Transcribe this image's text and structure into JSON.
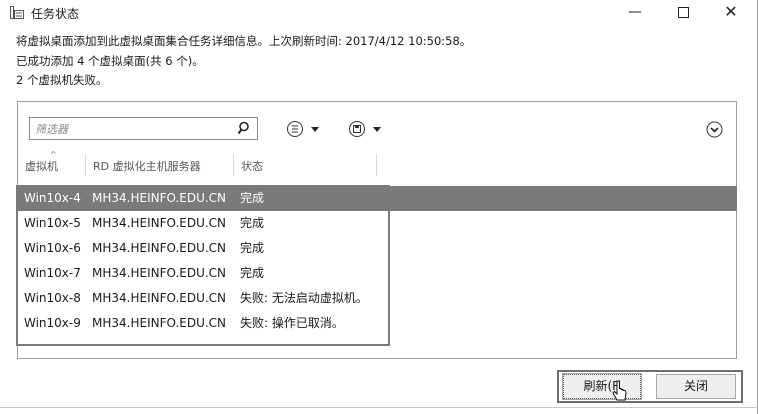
{
  "window": {
    "title": "任务状态",
    "minimize_glyph": "—",
    "close_glyph": "✕"
  },
  "info": {
    "line1": "将虚拟桌面添加到此虚拟桌面集合任务详细信息。上次刷新时间: 2017/4/12 10:50:58。",
    "line2": "已成功添加 4 个虚拟桌面(共 6 个)。",
    "line3": "2 个虚拟机失败。"
  },
  "filter": {
    "placeholder": "筛选器"
  },
  "columns": [
    "虚拟机",
    "RD 虚拟化主机服务器",
    "状态"
  ],
  "rows": [
    {
      "vm": "Win10x-4",
      "server": "MH34.HEINFO.EDU.CN",
      "status": "完成",
      "selected": true
    },
    {
      "vm": "Win10x-5",
      "server": "MH34.HEINFO.EDU.CN",
      "status": "完成",
      "selected": false
    },
    {
      "vm": "Win10x-6",
      "server": "MH34.HEINFO.EDU.CN",
      "status": "完成",
      "selected": false
    },
    {
      "vm": "Win10x-7",
      "server": "MH34.HEINFO.EDU.CN",
      "status": "完成",
      "selected": false
    },
    {
      "vm": "Win10x-8",
      "server": "MH34.HEINFO.EDU.CN",
      "status": "失败: 无法启动虚拟机。",
      "selected": false
    },
    {
      "vm": "Win10x-9",
      "server": "MH34.HEINFO.EDU.CN",
      "status": "失败: 操作已取消。",
      "selected": false
    }
  ],
  "buttons": {
    "refresh": "刷新(R",
    "close": "关闭"
  },
  "icons": {
    "app": "server-manager-icon",
    "search": "search-icon",
    "list": "list-options-icon",
    "save": "save-query-icon",
    "expand": "expand-circle-icon"
  },
  "colors": {
    "selected_row": "#7a7a7a",
    "frame": "#7a7a7a"
  }
}
